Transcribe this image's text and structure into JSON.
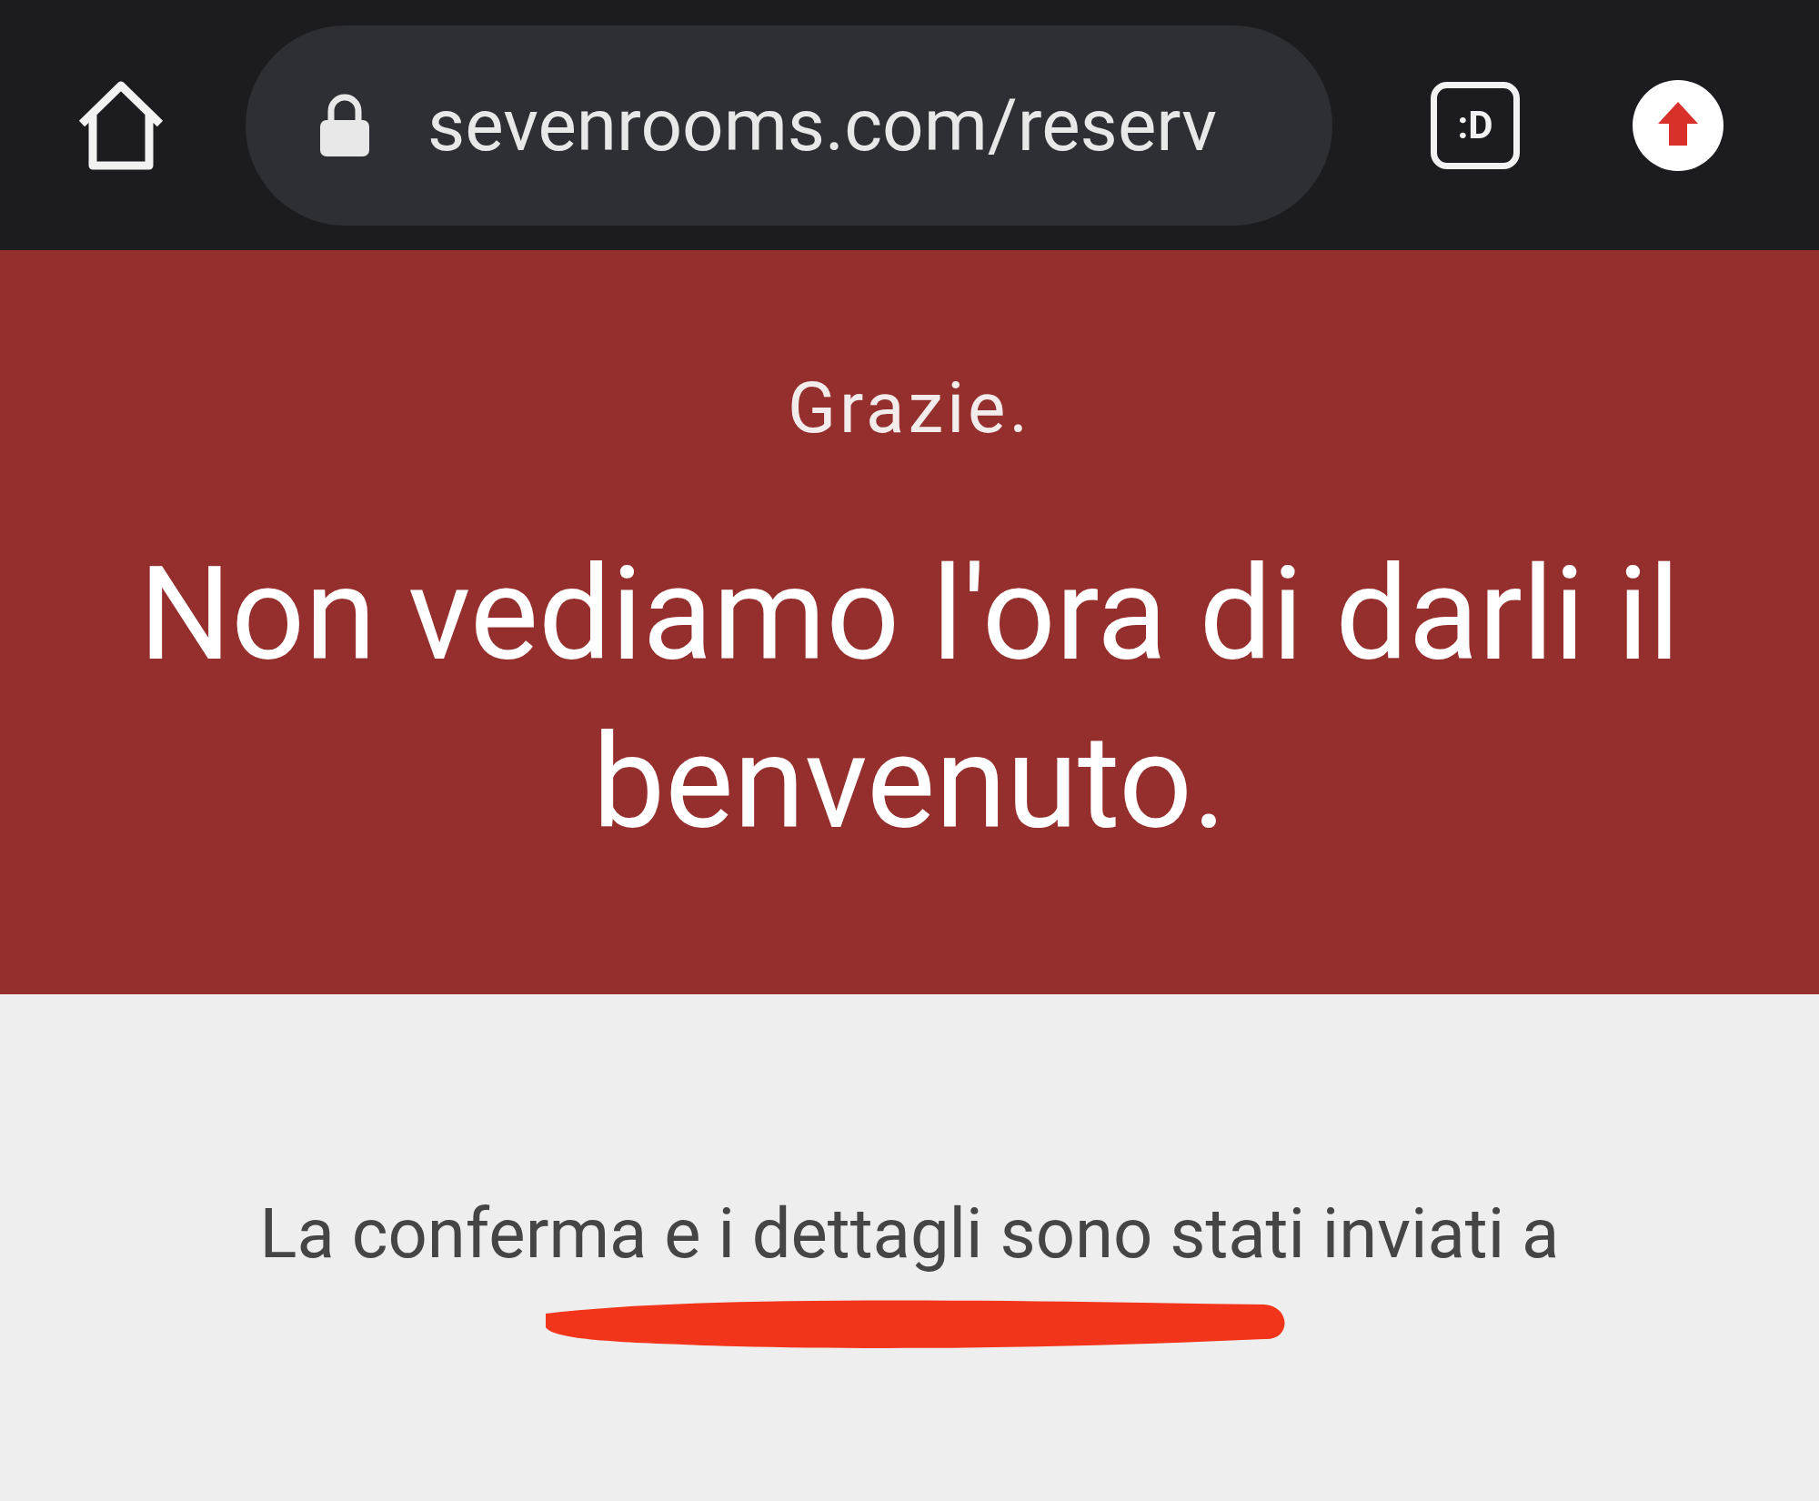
{
  "browser": {
    "url": "sevenrooms.com/reserv",
    "tab_badge": ":D"
  },
  "banner": {
    "kicker": "Grazie.",
    "headline": "Non vediamo l'ora di darli il benvenuto."
  },
  "body": {
    "message": "La conferma e i dettagli sono stati inviati a",
    "redacted": true
  }
}
